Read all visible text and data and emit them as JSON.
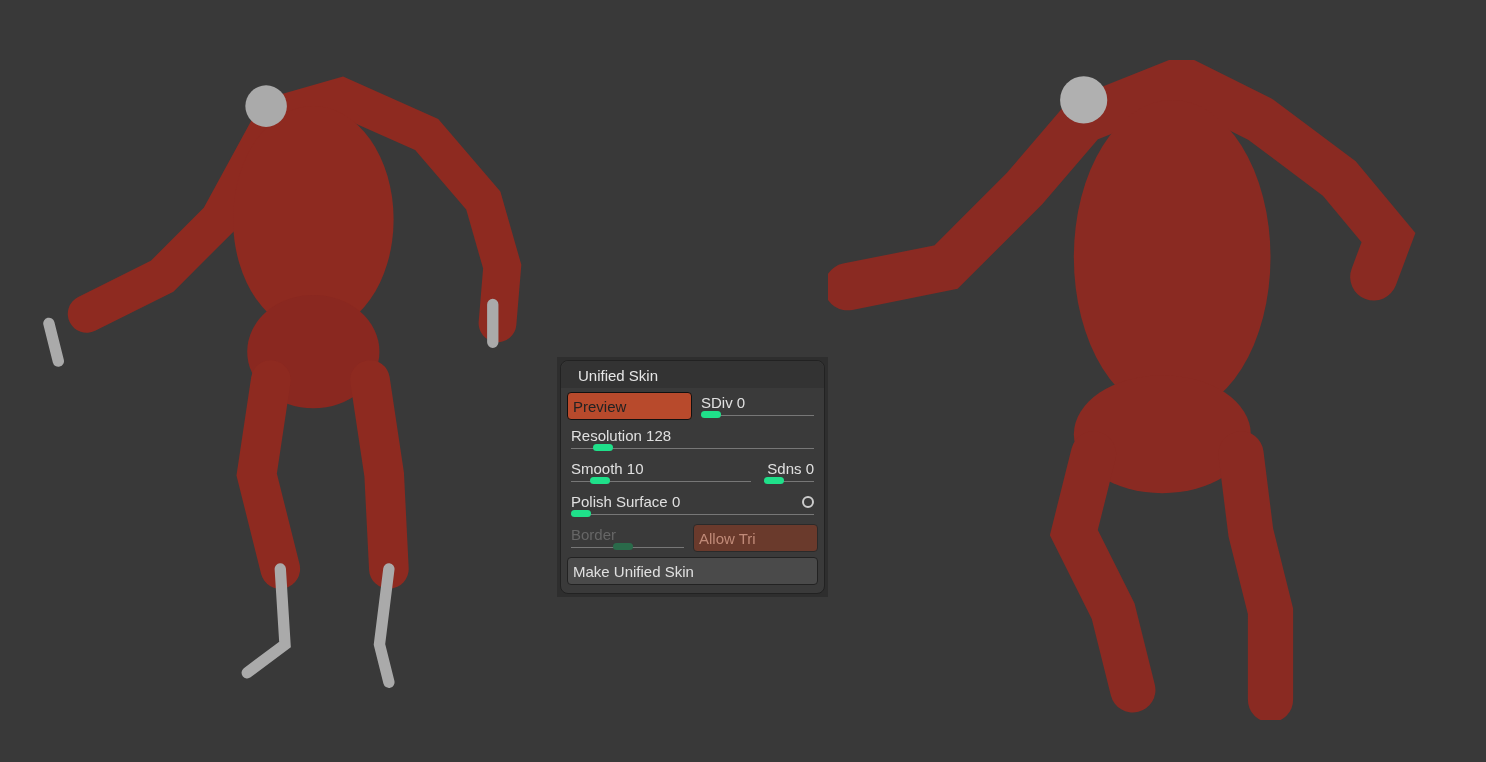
{
  "panel": {
    "title": "Unified Skin",
    "rows": [
      {
        "items": [
          {
            "kind": "button",
            "label": "Preview",
            "on": true,
            "disabled": false
          },
          {
            "kind": "slider",
            "label": "SDiv",
            "value": "0",
            "level": 0,
            "disabled": false
          }
        ]
      },
      {
        "items": [
          {
            "kind": "slider",
            "label": "Resolution",
            "value": "128",
            "level": 0.1,
            "disabled": false
          }
        ]
      },
      {
        "items": [
          {
            "kind": "slider",
            "label": "Smooth",
            "value": "10",
            "level": 0.12,
            "disabled": false
          },
          {
            "kind": "slider",
            "label": "Sdns",
            "value": "0",
            "level": 0,
            "disabled": false
          }
        ]
      },
      {
        "items": [
          {
            "kind": "slider",
            "label": "Polish Surface",
            "value": "0",
            "level": 0,
            "disabled": false,
            "dot": true
          }
        ]
      },
      {
        "items": [
          {
            "kind": "slider",
            "label": "Border",
            "value": "",
            "level": 0.45,
            "disabled": true
          },
          {
            "kind": "button",
            "label": "Allow Tri",
            "on": true,
            "disabled": true
          }
        ]
      },
      {
        "items": [
          {
            "kind": "button",
            "label": "Make Unified Skin",
            "on": false,
            "disabled": false
          }
        ]
      }
    ]
  }
}
